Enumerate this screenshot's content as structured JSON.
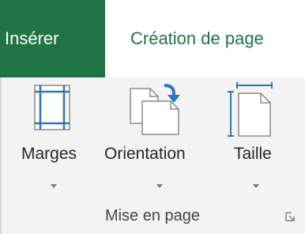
{
  "tabs": {
    "insert": "Insérer",
    "page_layout": "Création de page"
  },
  "commands": {
    "margins": {
      "label": "Marges",
      "icon": "margins-icon"
    },
    "orientation": {
      "label": "Orientation",
      "icon": "orientation-icon"
    },
    "size": {
      "label": "Taille",
      "icon": "page-size-icon"
    }
  },
  "group": {
    "label": "Mise en page",
    "launcher_icon": "dialog-launcher-icon"
  },
  "colors": {
    "accent": "#217346",
    "ribbon_bg": "#f3f3f3",
    "icon_blue": "#2e75b6"
  }
}
